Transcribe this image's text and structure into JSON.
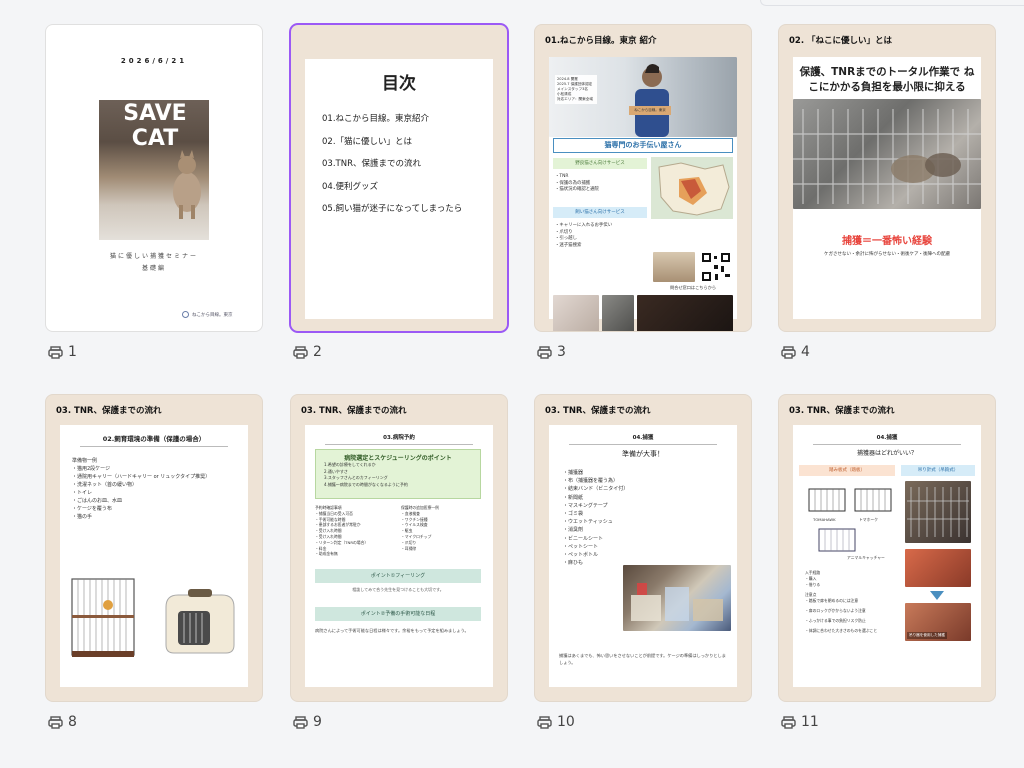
{
  "pages": [
    {
      "number": "1",
      "cover": {
        "date": "2026/6/21",
        "title": "SAVE CAT",
        "subtitle": "猫に優しい捕獲セミナー",
        "subtitle2": "基礎編",
        "logo_text": "ねこから目線。東京"
      }
    },
    {
      "number": "2",
      "toc": {
        "title": "目次",
        "items": [
          "01.ねこから目線。東京紹介",
          "02.「猫に優しい」とは",
          "03.TNR、保護までの流れ",
          "04.便利グッズ",
          "05.飼い猫が迷子になってしまったら"
        ]
      }
    },
    {
      "number": "3",
      "header": "01.ねこから目線。東京 紹介",
      "info": [
        "2024.8 開業",
        "2025.7 保護団体認定",
        "メインスタッフ3名",
        "小松清成",
        "対応エリア：関東全域"
      ],
      "sign": "ねこから目線。東京",
      "banner": "猫専門のお手伝い屋さん",
      "svc1_title": "野良猫さん向けサービス",
      "svc1_items": [
        "・TNR",
        "・保護の為の捕獲",
        "・猫状況の確認と通院"
      ],
      "svc2_title": "飼い猫さん向けサービス",
      "svc2_items": [
        "・キャリーに入れるお手伝い",
        "・爪切り",
        "・引っ越し",
        "・迷子猫捜索"
      ],
      "link": "問合せ窓口はこちらから"
    },
    {
      "number": "4",
      "header": "02. 「ねこに優しい」とは",
      "headline": "保護、TNRまでのトータル作業で ねこにかかる負担を最小限に抑える",
      "red": "捕獲＝一番怖い経験",
      "note": "ケガさせない・余計に怖がらせない・術後ケア・後陣への配慮"
    },
    {
      "number": "8",
      "header": "03. TNR、保護までの流れ",
      "sub": "02.飼育環境の準備（保護の場合）",
      "list_title": "準備物一例",
      "items": [
        "・猫用2段ケージ",
        "・通院用キャリー（ハードキャリー or リュックタイプ推奨）",
        "・洗濯ネット（首の緩い物）",
        "・トイレ",
        "・ごはんのお皿、水皿",
        "・ケージを覆う布",
        "・猫の手"
      ]
    },
    {
      "number": "9",
      "header": "03. TNR、保護までの流れ",
      "sub": "03.病院予約",
      "box_title": "病院選定とスケジューリングのポイント",
      "box_items": [
        "1.希望の診療をしてくれるか",
        "2.通いやすさ",
        "3.スタッフさんとのカフィーリング",
        "4.捕獲～病院までの時間がなくなるように予約"
      ],
      "col1_title": "予約時確認事項",
      "col1_items": [
        "・捕獲当日の受入可否",
        "・手術可能な時間",
        "・患部するお医者が常駐か",
        "・受け入れ時間",
        "・受け入れ時間",
        "・リターン判定（TNRの場合）",
        "・料金",
        "・助成金有無"
      ],
      "col2_title": "保護時の追加医療一例",
      "col2_items": [
        "・血液検査",
        "・ワクチン接種",
        "・ウイルス検査",
        "・駆虫",
        "・マイクロチップ",
        "・爪切り",
        "・耳掃除"
      ],
      "point1": "ポイント①フィーリング",
      "point1_text": "相談してみて合う先生を見つけることも大切です。",
      "point2": "ポイント②予備の手術可能な日程",
      "body": "病院さんによって手術可能な日程は様々です。余裕をもって予定を組みましょう。"
    },
    {
      "number": "10",
      "header": "03. TNR、保護までの流れ",
      "sub": "04.捕獲",
      "lead": "準備が大事！",
      "items": [
        "・捕獲器",
        "・布（捕獲器を覆う為）",
        "・結束バンド（ビニタイ付）",
        "・新聞紙",
        "・マスキングテープ",
        "・ゴミ袋",
        "・ウエットティッシュ",
        "・消臭剤",
        "・ビニールシート",
        "・ペットシート",
        "・ペットボトル",
        "・麻ひも"
      ],
      "footer": "捕獲はあくまでも、怖い思いをさせないことが前提です。ケージの準備はしっかりとしましょう。"
    },
    {
      "number": "11",
      "header": "03. TNR、保護までの流れ",
      "sub": "04.捕獲",
      "lead": "捕獲器はどれがいい？",
      "tag1": "踏み板式（踏板）",
      "tag2": "吊り針式（吊鉤式）",
      "lbl1": "TOMAHAWK",
      "lbl2": "トマホーク",
      "lbl3": "アニマルキャッチャー",
      "notes": [
        "入手経路",
        "・購入",
        "・借りる",
        "注意点",
        "・踏板で扉を閉めるのには注意",
        "・扉のロックがかからないよう注意",
        "・ふっかける事での負担リスク防止",
        "・体調に合わせた大きさのものを選ぶこと"
      ],
      "tag3": "吊り器を使用した捕獲"
    }
  ],
  "colors": {
    "beige": "#eee3d6",
    "select": "#9b59f5",
    "green": "#e3f3d6",
    "blue": "#d6ecf8",
    "red": "#e8443c",
    "teal_band": "#cfe7de"
  }
}
